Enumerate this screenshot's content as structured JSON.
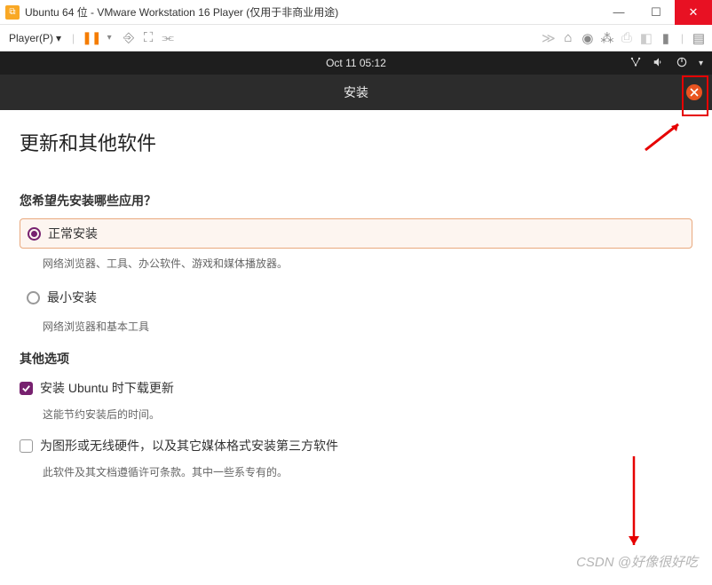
{
  "vmware": {
    "title": "Ubuntu 64 位 - VMware Workstation 16 Player (仅用于非商业用途)",
    "player_label": "Player(P)"
  },
  "ubuntu_top": {
    "datetime": "Oct 11  05:12"
  },
  "installer": {
    "header_title": "安装",
    "page_title": "更新和其他软件",
    "install_type_q": "您希望先安装哪些应用？",
    "normal_install": "正常安装",
    "normal_desc": "网络浏览器、工具、办公软件、游戏和媒体播放器。",
    "minimal_install": "最小安装",
    "minimal_desc": "网络浏览器和基本工具",
    "other_options": "其他选项",
    "download_updates": "安装 Ubuntu 时下载更新",
    "download_updates_desc": "这能节约安装后的时间。",
    "third_party": "为图形或无线硬件，以及其它媒体格式安装第三方软件",
    "third_party_desc": "此软件及其文档遵循许可条款。其中一些系专有的。"
  },
  "watermark": "CSDN @好像很好吃"
}
